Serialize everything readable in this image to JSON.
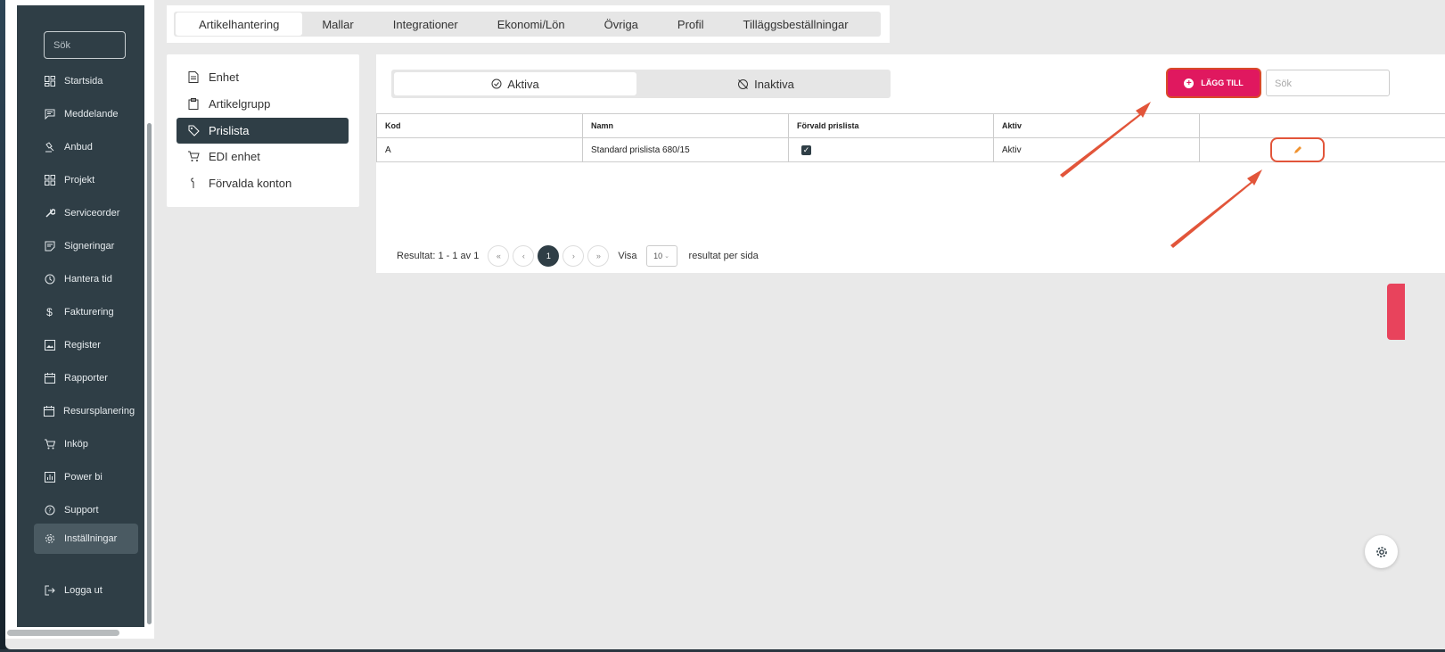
{
  "sidebar": {
    "search_placeholder": "Sök",
    "items": [
      {
        "label": "Startsida",
        "icon": "dashboard-icon"
      },
      {
        "label": "Meddelande",
        "icon": "message-icon"
      },
      {
        "label": "Anbud",
        "icon": "gavel-icon"
      },
      {
        "label": "Projekt",
        "icon": "grid-icon"
      },
      {
        "label": "Serviceorder",
        "icon": "wrench-icon"
      },
      {
        "label": "Signeringar",
        "icon": "sign-icon"
      },
      {
        "label": "Hantera tid",
        "icon": "clock-icon"
      },
      {
        "label": "Fakturering",
        "icon": "dollar-icon"
      },
      {
        "label": "Register",
        "icon": "image-icon"
      },
      {
        "label": "Rapporter",
        "icon": "calendar-icon"
      },
      {
        "label": "Resursplanering",
        "icon": "calendar-icon"
      },
      {
        "label": "Inköp",
        "icon": "cart-icon"
      },
      {
        "label": "Power bi",
        "icon": "chart-icon"
      },
      {
        "label": "Support",
        "icon": "help-icon"
      },
      {
        "label": "Inställningar",
        "icon": "gear-icon"
      }
    ],
    "logout_label": "Logga ut"
  },
  "tabs": [
    "Artikelhantering",
    "Mallar",
    "Integrationer",
    "Ekonomi/Lön",
    "Övriga",
    "Profil",
    "Tilläggsbeställningar"
  ],
  "submenu": [
    "Enhet",
    "Artikelgrupp",
    "Prislista",
    "EDI enhet",
    "Förvalda konton"
  ],
  "toggle": {
    "active_label": "Aktiva",
    "inactive_label": "Inaktiva"
  },
  "add_button_label": "LÄGG TILL",
  "search_placeholder": "Sök",
  "table": {
    "headers": [
      "Kod",
      "Namn",
      "Förvald prislista",
      "Aktiv",
      ""
    ],
    "rows": [
      {
        "kod": "A",
        "namn": "Standard prislista 680/15",
        "forvald": true,
        "aktiv": "Aktiv"
      }
    ]
  },
  "pagination": {
    "result_text": "Resultat: 1 - 1 av 1",
    "first": "«",
    "prev": "‹",
    "current": "1",
    "next": "›",
    "last": "»",
    "show_label": "Visa",
    "per_page": "10",
    "per_page_suffix": "resultat per sida"
  },
  "colors": {
    "sidebar_bg": "#2f3e46",
    "accent_pink": "#e0185f",
    "annotation_red": "#e2553a",
    "edit_icon": "#f0922f"
  }
}
